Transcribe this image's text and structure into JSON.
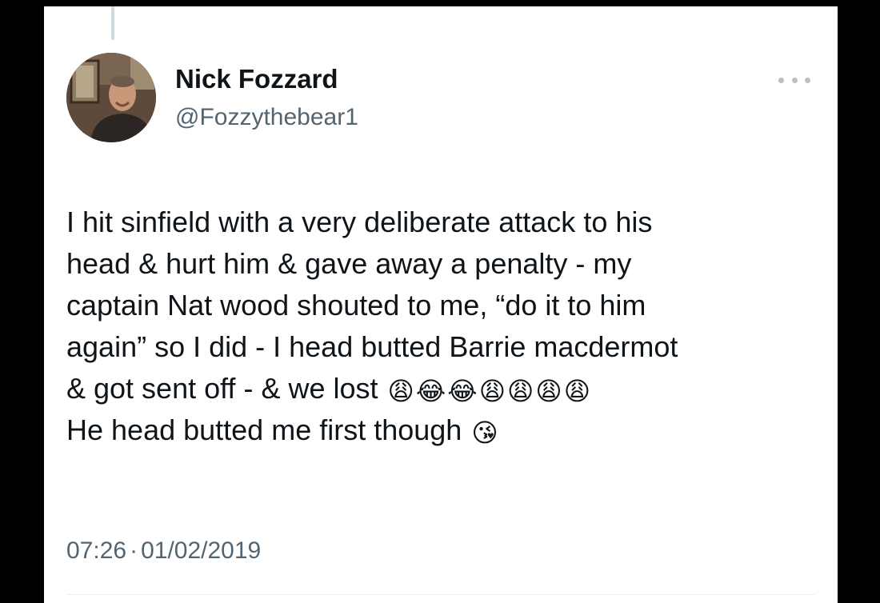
{
  "author": {
    "display_name": "Nick Fozzard",
    "handle": "@Fozzythebear1"
  },
  "tweet": {
    "lines": [
      "I hit sinfield with a very deliberate attack to his",
      "head & hurt him & gave away a penalty - my",
      "captain Nat wood shouted to me, “do it to him",
      "again” so I did - I head butted Barrie macdermot",
      "& got sent off - & we lost",
      "He head butted me first though"
    ],
    "line5_emojis": [
      "😩",
      "😂",
      "😂",
      "😩",
      "😩",
      "😩",
      "😩"
    ],
    "line6_emoji": "😘"
  },
  "meta": {
    "time": "07:26",
    "separator": "·",
    "date": "01/02/2019"
  },
  "icons": {
    "more": "more-horizontal-icon"
  }
}
